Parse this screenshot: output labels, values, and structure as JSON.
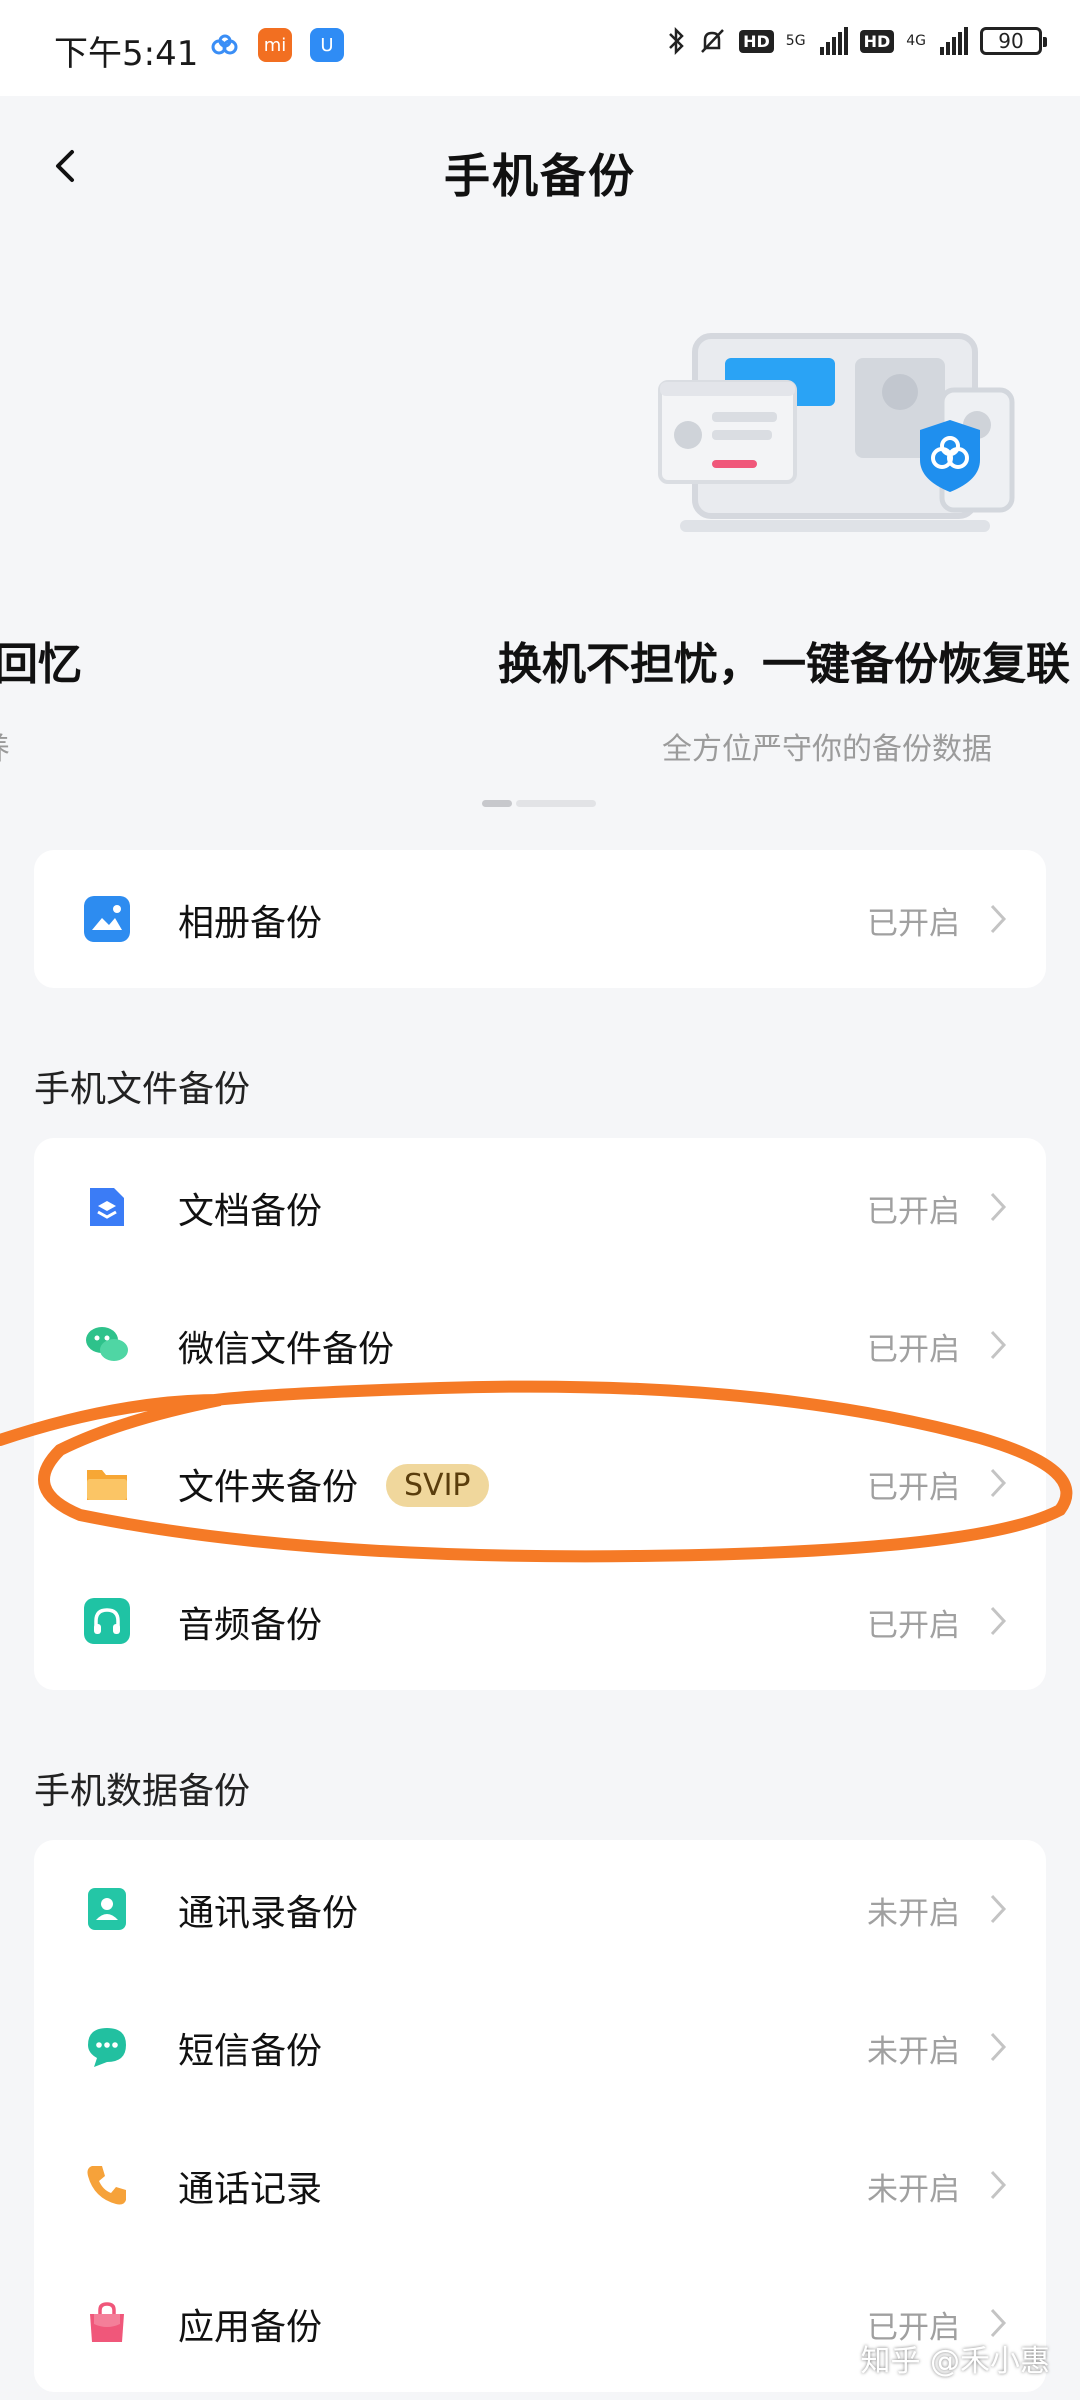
{
  "status_bar": {
    "time": "下午5:41",
    "battery": "90",
    "net_5g": "5G",
    "net_4g": "4G",
    "hd": "HD"
  },
  "header": {
    "title": "手机备份"
  },
  "banner": {
    "left_slogan": "回忆",
    "left_sub": "养",
    "right_slogan": "换机不担忧，一键备份恢复联",
    "right_sub": "全方位严守你的备份数据"
  },
  "album_card": {
    "items": [
      {
        "label": "相册备份",
        "status": "已开启",
        "icon": "photo-icon",
        "color": "#2d8cf0"
      }
    ]
  },
  "file_section": {
    "title": "手机文件备份",
    "items": [
      {
        "label": "文档备份",
        "status": "已开启",
        "icon": "document-icon",
        "color": "#3b7cf6"
      },
      {
        "label": "微信文件备份",
        "status": "已开启",
        "icon": "wechat-icon",
        "color": "#2ec28b"
      },
      {
        "label": "文件夹备份",
        "badge": "SVIP",
        "status": "已开启",
        "icon": "folder-icon",
        "color": "#f7a735"
      },
      {
        "label": "音频备份",
        "status": "已开启",
        "icon": "headphone-icon",
        "color": "#1fc3a4"
      }
    ]
  },
  "data_section": {
    "title": "手机数据备份",
    "items": [
      {
        "label": "通讯录备份",
        "status": "未开启",
        "icon": "contact-icon",
        "color": "#24c6a6"
      },
      {
        "label": "短信备份",
        "status": "未开启",
        "icon": "message-icon",
        "color": "#22c0a0"
      },
      {
        "label": "通话记录",
        "status": "未开启",
        "icon": "phone-icon",
        "color": "#f6a23a"
      },
      {
        "label": "应用备份",
        "status": "已开启",
        "icon": "app-bag-icon",
        "color": "#f0577a"
      }
    ]
  },
  "watermark": "知乎 @禾小惠",
  "colors": {
    "annotation": "#f57a26",
    "svip_bg": "#f0d79c",
    "status_text": "#a0a0a0"
  }
}
